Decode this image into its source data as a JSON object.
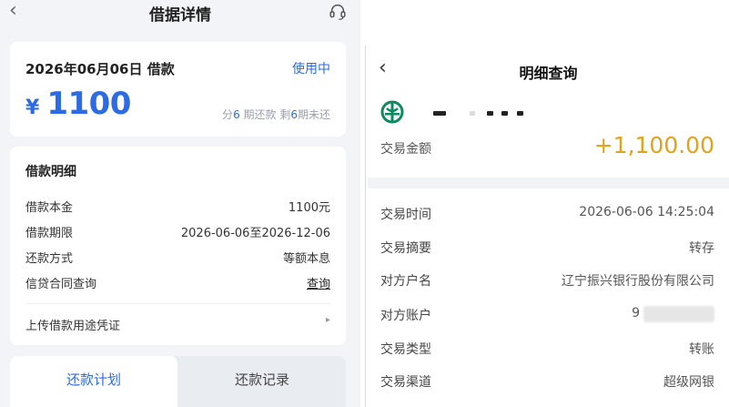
{
  "left": {
    "header": {
      "title": "借据详情",
      "back_icon": "chevron-left-icon",
      "service_icon": "headset-icon"
    },
    "loan": {
      "title": "2026年06月06日 借款",
      "status": "使用中",
      "currency": "¥",
      "amount": "1100",
      "term_prefix": "分",
      "term_total": "6",
      "term_mid": " 期还款 剩",
      "term_remaining": "6",
      "term_suffix": "期未还"
    },
    "details": {
      "title": "借款明细",
      "rows": [
        {
          "label": "借款本金",
          "value": "1100元"
        },
        {
          "label": "借款期限",
          "value": "2026-06-06至2026-12-06"
        },
        {
          "label": "还款方式",
          "value": "等额本息"
        },
        {
          "label": "信贷合同查询",
          "value": "查询"
        }
      ],
      "upload_label": "上传借款用途凭证"
    },
    "tabs": [
      {
        "label": "还款计划",
        "active": true
      },
      {
        "label": "还款记录",
        "active": false
      }
    ],
    "colors": {
      "accent": "#2d6be4"
    }
  },
  "right": {
    "title": "明细查询",
    "bank_icon": "agricultural-bank-logo-icon",
    "amount_label": "交易金额",
    "amount_value": "+1,100.00",
    "rows": [
      {
        "label": "交易时间",
        "value": "2026-06-06 14:25:04"
      },
      {
        "label": "交易摘要",
        "value": "转存"
      },
      {
        "label": "对方户名",
        "value": "辽宁振兴银行股份有限公司"
      },
      {
        "label": "对方账户",
        "value": "9"
      },
      {
        "label": "交易类型",
        "value": "转账"
      },
      {
        "label": "交易渠道",
        "value": "超级网银"
      }
    ],
    "colors": {
      "amount": "#e2a219",
      "bank_logo": "#0e8a5f"
    }
  }
}
